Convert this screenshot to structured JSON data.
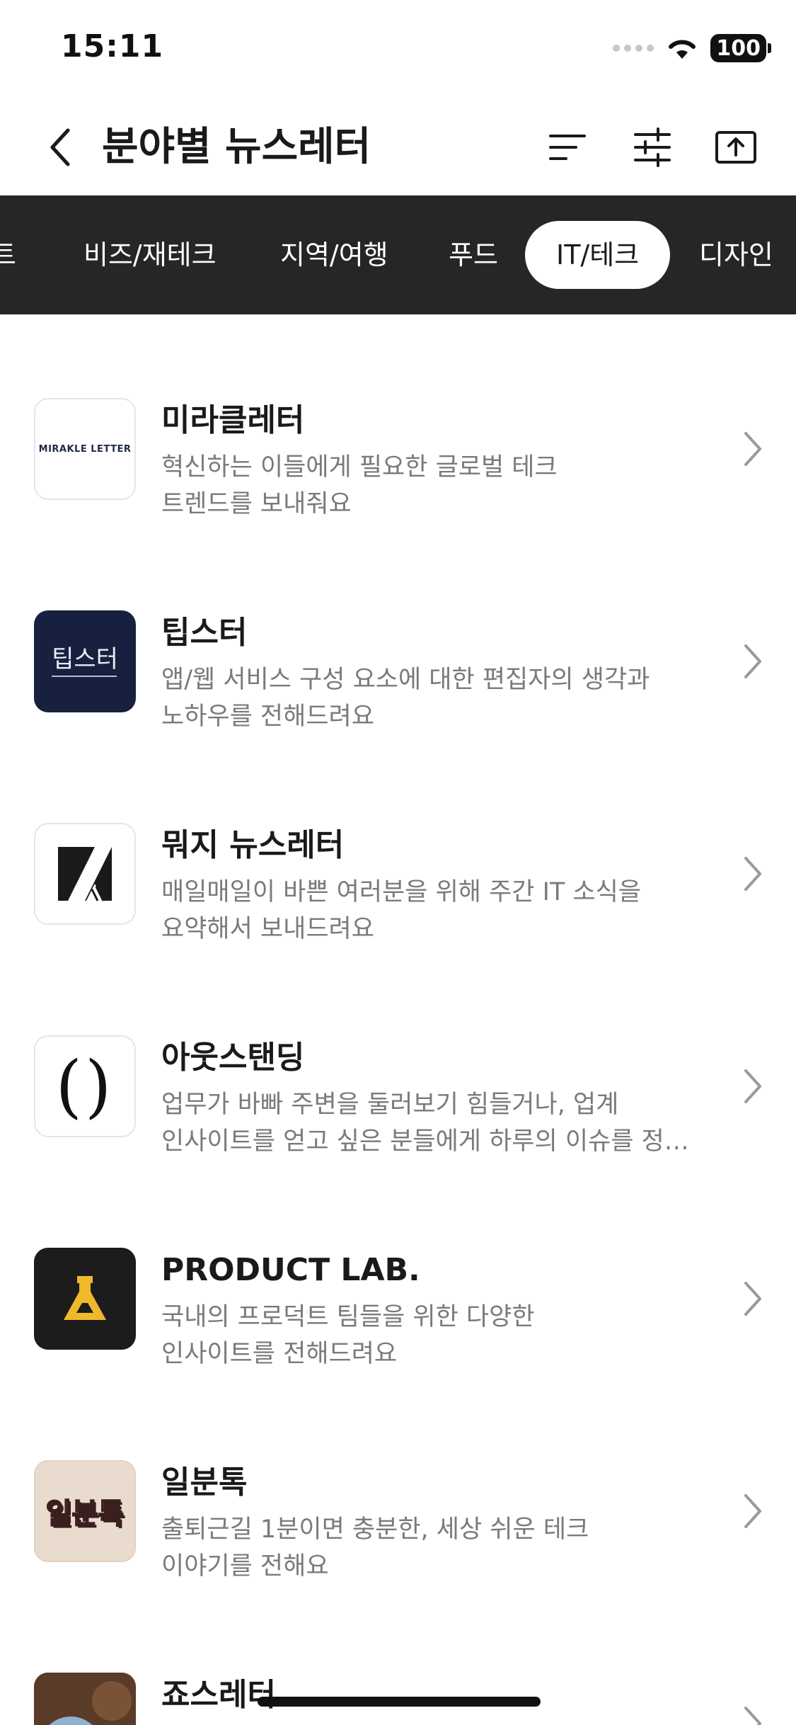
{
  "status_bar": {
    "time": "15:11",
    "battery": "100"
  },
  "header": {
    "title": "분야별 뉴스레터"
  },
  "tabs": [
    {
      "label": "트"
    },
    {
      "label": "비즈/재테크"
    },
    {
      "label": "지역/여행"
    },
    {
      "label": "푸드"
    },
    {
      "label": "IT/테크",
      "active": true
    },
    {
      "label": "디자인"
    }
  ],
  "items": [
    {
      "name": "미라클레터",
      "logo_text": "MIRAKLE LETTER",
      "desc": [
        "혁신하는 이들에게 필요한 글로벌 테크",
        "트렌드를 보내줘요"
      ]
    },
    {
      "name": "팁스터",
      "logo_text": "팁스터",
      "desc": [
        "앱/웹 서비스 구성 요소에 대한 편집자의 생각과",
        "노하우를 전해드려요"
      ]
    },
    {
      "name": "뭐지 뉴스레터",
      "desc": [
        "매일매일이 바쁜 여러분을 위해 주간 IT 소식을",
        "요약해서 보내드려요"
      ]
    },
    {
      "name": "아웃스탠딩",
      "logo_text": "()",
      "desc": [
        "업무가 바빠 주변을 둘러보기 힘들거나, 업계",
        "인사이트를 얻고 싶은 분들에게 하루의 이슈를 정리해드려요"
      ]
    },
    {
      "name": "PRODUCT LAB.",
      "desc": [
        "국내의 프로덕트 팀들을 위한 다양한",
        "인사이트를 전해드려요"
      ]
    },
    {
      "name": "일분톡",
      "logo_text": "일분톡",
      "desc": [
        "출퇴근길 1분이면 충분한, 세상 쉬운 테크",
        "이야기를 전해요"
      ]
    },
    {
      "name": "죠스레터"
    }
  ],
  "colors": {
    "tab_bar": "#262626",
    "accent_yellow": "#f0b92c",
    "navy": "#17203f"
  }
}
